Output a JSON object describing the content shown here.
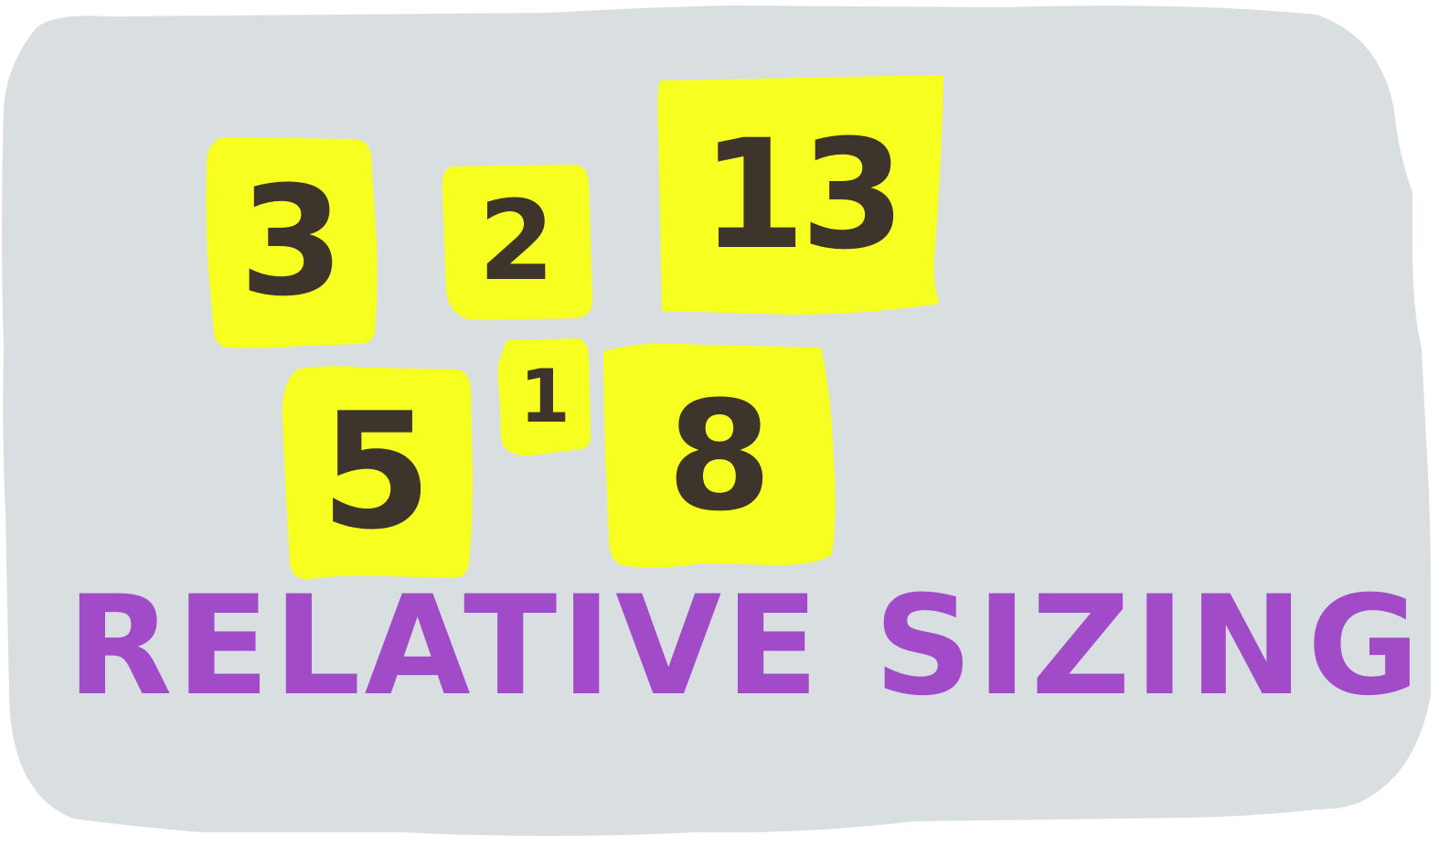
{
  "colors": {
    "background_blob": "#d9dee1",
    "sticky_note": "#f7ff20",
    "number_ink": "#3d342c",
    "title_ink": "#a24bc9"
  },
  "notes": [
    {
      "id": "note-3",
      "value": "3"
    },
    {
      "id": "note-2",
      "value": "2"
    },
    {
      "id": "note-13",
      "value": "13"
    },
    {
      "id": "note-5",
      "value": "5"
    },
    {
      "id": "note-1",
      "value": "1"
    },
    {
      "id": "note-8",
      "value": "8"
    }
  ],
  "title": "RELATIVE SIZING"
}
